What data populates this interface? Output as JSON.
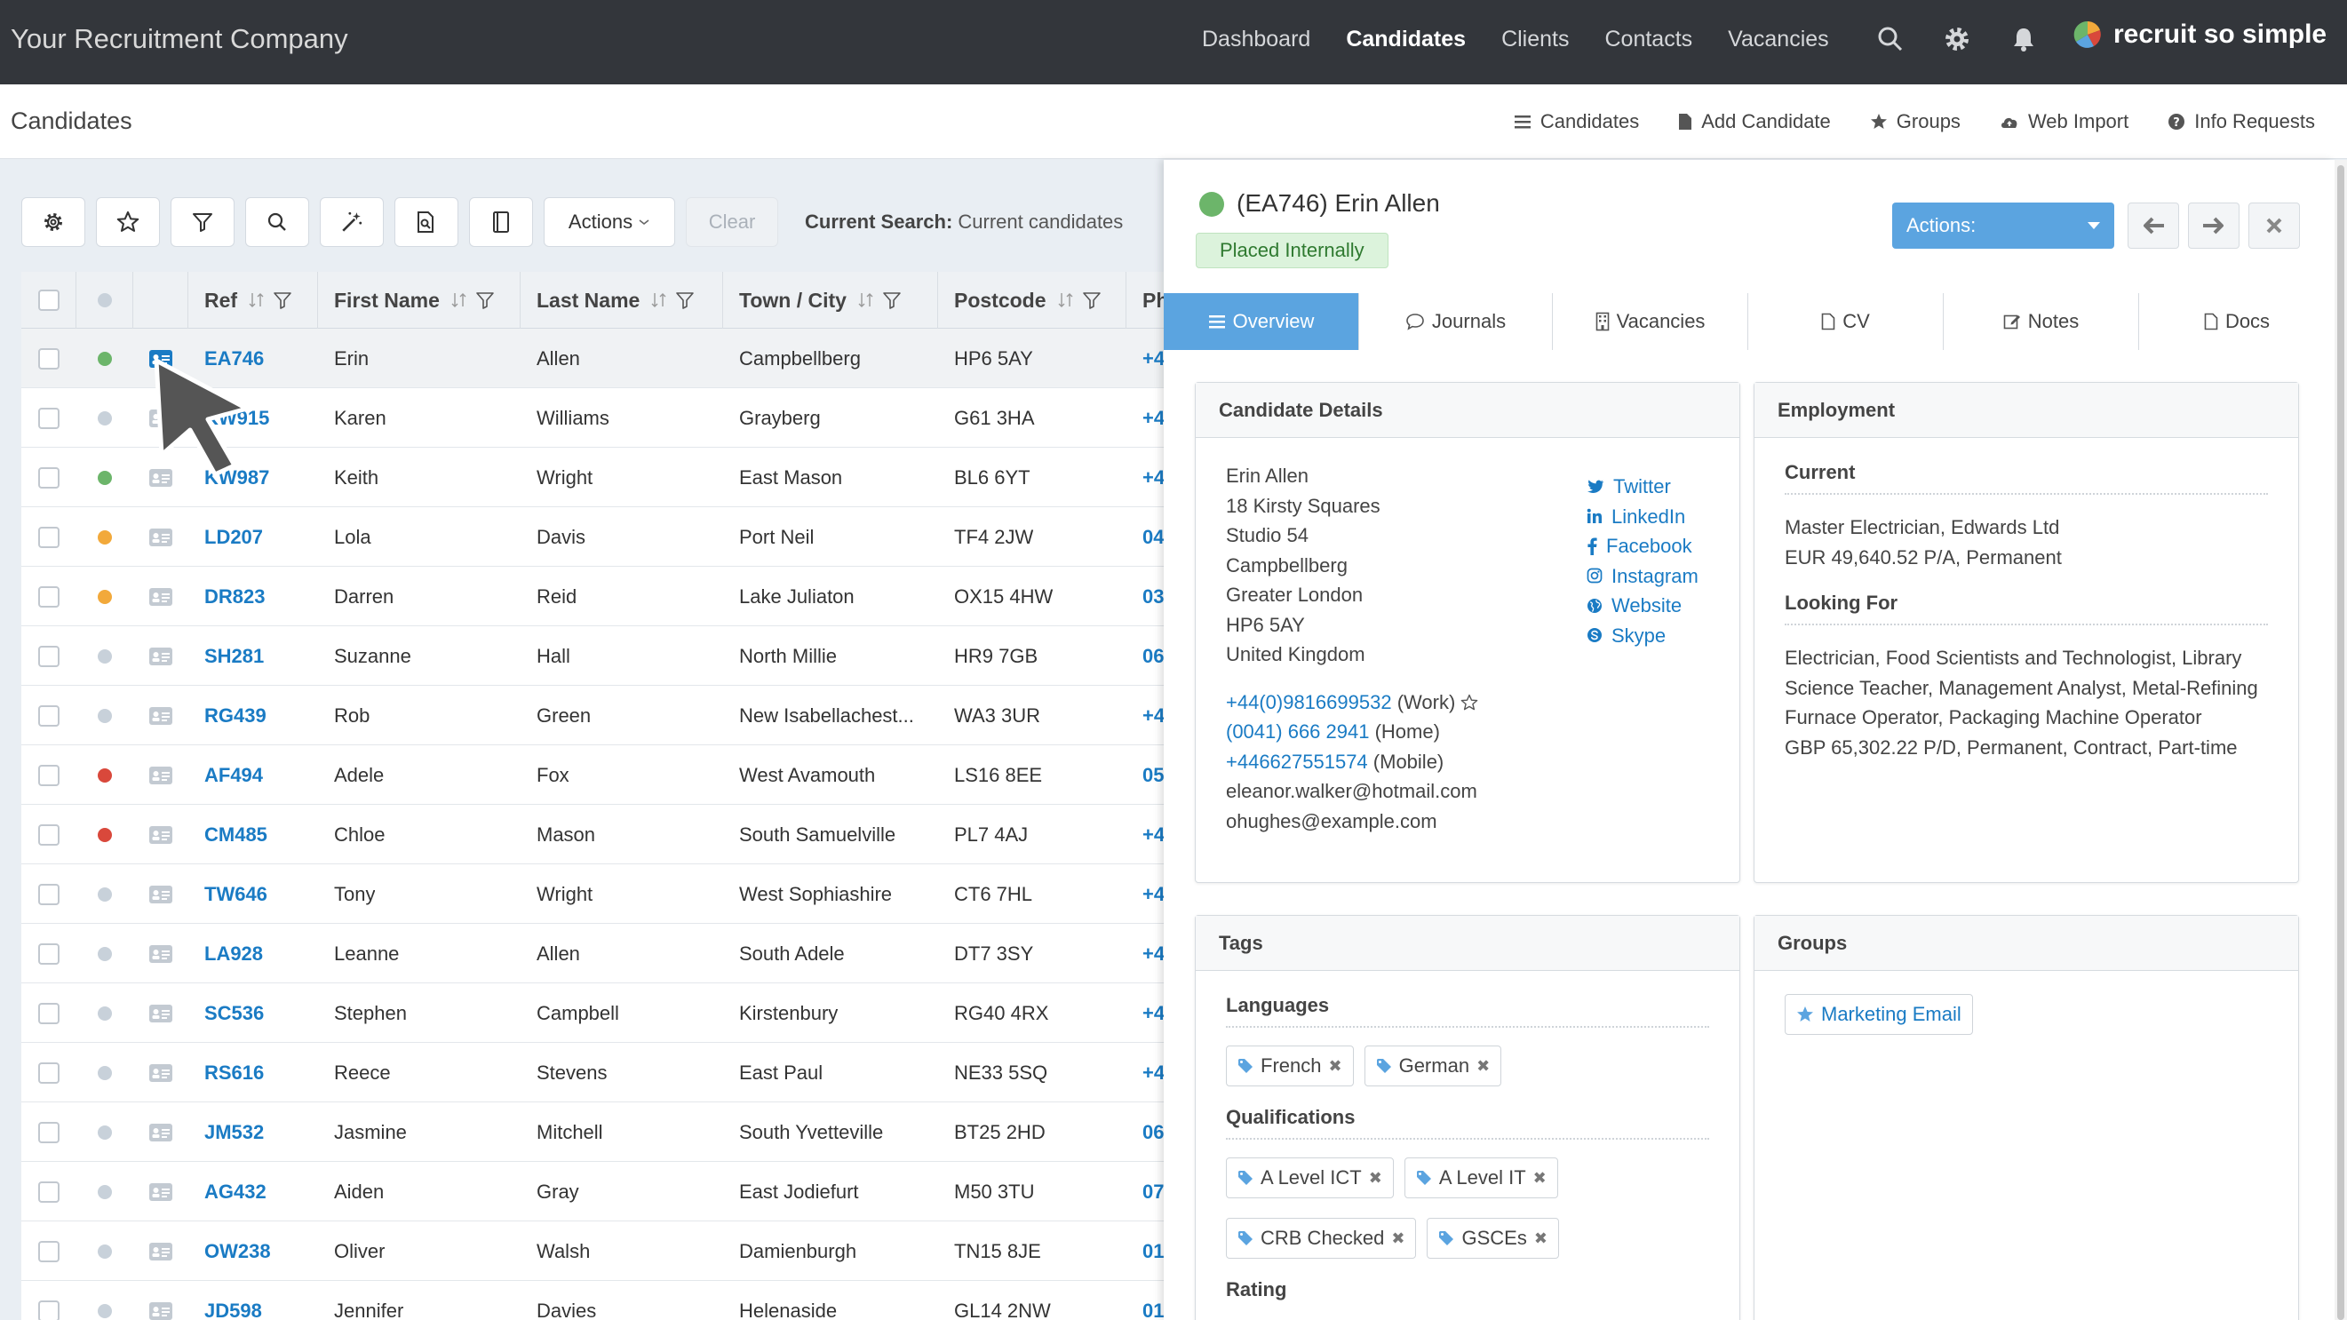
{
  "app": {
    "company": "Your Recruitment Company",
    "brand": "recruit so simple",
    "nav": [
      "Dashboard",
      "Candidates",
      "Clients",
      "Contacts",
      "Vacancies"
    ],
    "active_nav": "Candidates"
  },
  "subbar": {
    "title": "Candidates",
    "links": [
      "Candidates",
      "Add Candidate",
      "Groups",
      "Web Import",
      "Info Requests"
    ]
  },
  "toolbar": {
    "icons": [
      "gear-icon",
      "star-icon",
      "filter-icon",
      "search-icon",
      "magic-wand-icon",
      "document-search-icon",
      "notebook-icon"
    ],
    "actions_label": "Actions",
    "clear_label": "Clear",
    "current_search_label": "Current Search:",
    "current_search_value": "Current candidates"
  },
  "table": {
    "columns": [
      "Ref",
      "First Name",
      "Last Name",
      "Town / City",
      "Postcode",
      "Ph"
    ],
    "rows": [
      {
        "status": "#6cb56a",
        "ref": "EA746",
        "first": "Erin",
        "last": "Allen",
        "town": "Campbellberg",
        "postcode": "HP6 5AY",
        "phone": "+4",
        "selected": true
      },
      {
        "status": "#c8d1da",
        "ref": "KW915",
        "first": "Karen",
        "last": "Williams",
        "town": "Grayberg",
        "postcode": "G61 3HA",
        "phone": "+4"
      },
      {
        "status": "#6cb56a",
        "ref": "KW987",
        "first": "Keith",
        "last": "Wright",
        "town": "East Mason",
        "postcode": "BL6 6YT",
        "phone": "+4"
      },
      {
        "status": "#f2a93b",
        "ref": "LD207",
        "first": "Lola",
        "last": "Davis",
        "town": "Port Neil",
        "postcode": "TF4 2JW",
        "phone": "04"
      },
      {
        "status": "#f2a93b",
        "ref": "DR823",
        "first": "Darren",
        "last": "Reid",
        "town": "Lake Juliaton",
        "postcode": "OX15 4HW",
        "phone": "03"
      },
      {
        "status": "#c8d1da",
        "ref": "SH281",
        "first": "Suzanne",
        "last": "Hall",
        "town": "North Millie",
        "postcode": "HR9 7GB",
        "phone": "06"
      },
      {
        "status": "#c8d1da",
        "ref": "RG439",
        "first": "Rob",
        "last": "Green",
        "town": "New Isabellachest...",
        "postcode": "WA3 3UR",
        "phone": "+4"
      },
      {
        "status": "#d9483b",
        "ref": "AF494",
        "first": "Adele",
        "last": "Fox",
        "town": "West Avamouth",
        "postcode": "LS16 8EE",
        "phone": "05"
      },
      {
        "status": "#d9483b",
        "ref": "CM485",
        "first": "Chloe",
        "last": "Mason",
        "town": "South Samuelville",
        "postcode": "PL7 4AJ",
        "phone": "+4"
      },
      {
        "status": "#c8d1da",
        "ref": "TW646",
        "first": "Tony",
        "last": "Wright",
        "town": "West Sophiashire",
        "postcode": "CT6 7HL",
        "phone": "+4"
      },
      {
        "status": "#c8d1da",
        "ref": "LA928",
        "first": "Leanne",
        "last": "Allen",
        "town": "South Adele",
        "postcode": "DT7 3SY",
        "phone": "+4"
      },
      {
        "status": "#c8d1da",
        "ref": "SC536",
        "first": "Stephen",
        "last": "Campbell",
        "town": "Kirstenbury",
        "postcode": "RG40 4RX",
        "phone": "+4"
      },
      {
        "status": "#c8d1da",
        "ref": "RS616",
        "first": "Reece",
        "last": "Stevens",
        "town": "East Paul",
        "postcode": "NE33 5SQ",
        "phone": "+4"
      },
      {
        "status": "#c8d1da",
        "ref": "JM532",
        "first": "Jasmine",
        "last": "Mitchell",
        "town": "South Yvetteville",
        "postcode": "BT25 2HD",
        "phone": "06"
      },
      {
        "status": "#c8d1da",
        "ref": "AG432",
        "first": "Aiden",
        "last": "Gray",
        "town": "East Jodiefurt",
        "postcode": "M50 3TU",
        "phone": "07"
      },
      {
        "status": "#c8d1da",
        "ref": "OW238",
        "first": "Oliver",
        "last": "Walsh",
        "town": "Damienburgh",
        "postcode": "TN15 8JE",
        "phone": "01"
      },
      {
        "status": "#c8d1da",
        "ref": "JD598",
        "first": "Jennifer",
        "last": "Davies",
        "town": "Helenaside",
        "postcode": "GL14 2NW",
        "phone": "01"
      }
    ]
  },
  "detail": {
    "status_color": "#6cb56a",
    "title": "(EA746) Erin Allen",
    "badge": "Placed Internally",
    "actions_label": "Actions:",
    "tabs": [
      "Overview",
      "Journals",
      "Vacancies",
      "CV",
      "Notes",
      "Docs"
    ],
    "active_tab": "Overview",
    "candidate_details": {
      "heading": "Candidate Details",
      "address": [
        "Erin Allen",
        "18 Kirsty Squares",
        "Studio 54",
        "Campbellberg",
        "Greater London",
        "HP6 5AY",
        "United Kingdom"
      ],
      "phones": [
        {
          "number": "+44(0)9816699532",
          "type": "(Work)"
        },
        {
          "number": "(0041) 666 2941",
          "type": "(Home)"
        },
        {
          "number": "+446627551574",
          "type": "(Mobile)"
        }
      ],
      "emails": [
        "eleanor.walker@hotmail.com",
        "ohughes@example.com"
      ],
      "social": [
        "Twitter",
        "LinkedIn",
        "Facebook",
        "Instagram",
        "Website",
        "Skype"
      ]
    },
    "employment": {
      "heading": "Employment",
      "current_label": "Current",
      "current": [
        "Master Electrician, Edwards Ltd",
        "EUR 49,640.52 P/A, Permanent"
      ],
      "looking_label": "Looking For",
      "looking": "Electrician, Food Scientists and Technologist, Library Science Teacher, Management Analyst, Metal-Refining Furnace Operator, Packaging Machine Operator",
      "looking_salary": "GBP 65,302.22 P/D, Permanent, Contract, Part-time"
    },
    "tags": {
      "heading": "Tags",
      "languages_label": "Languages",
      "languages": [
        "French",
        "German"
      ],
      "qualifications_label": "Qualifications",
      "qualifications": [
        "A Level ICT",
        "A Level IT",
        "CRB Checked",
        "GSCEs"
      ],
      "rating_label": "Rating"
    },
    "groups": {
      "heading": "Groups",
      "items": [
        "Marketing Email"
      ]
    }
  }
}
